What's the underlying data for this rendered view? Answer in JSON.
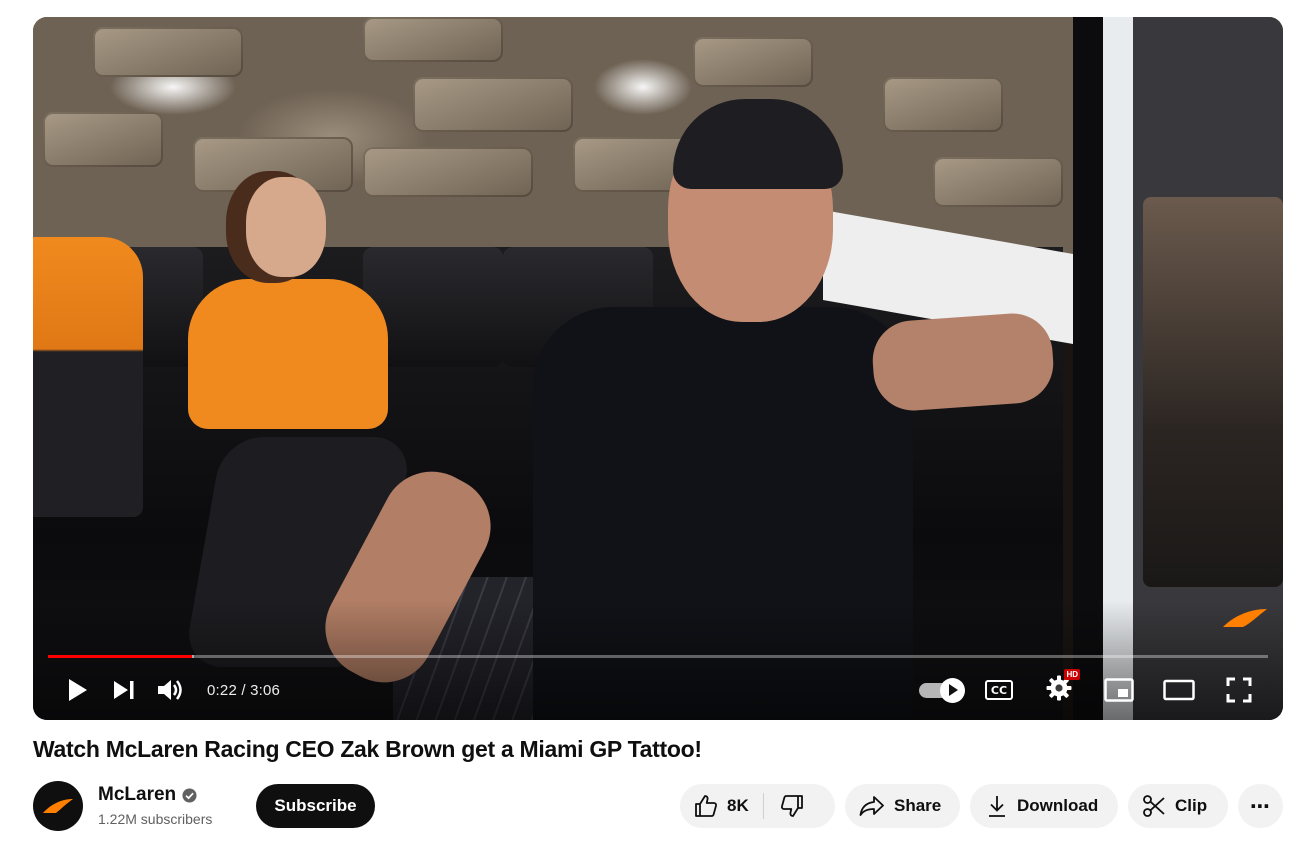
{
  "video": {
    "current_time": "0:22",
    "duration": "3:06",
    "time_display": "0:22 / 3:06",
    "progress_fraction": 0.118,
    "buffered_fraction": 0.12,
    "quality_badge": "HD",
    "captions_label": "CC",
    "autoplay_on": true,
    "watermark": "mclaren-logo"
  },
  "title": "Watch McLaren Racing CEO Zak Brown get a Miami GP Tattoo!",
  "channel": {
    "name": "McLaren",
    "verified": true,
    "subscribers": "1.22M subscribers",
    "subscribe_label": "Subscribe"
  },
  "actions": {
    "like_count": "8K",
    "share_label": "Share",
    "download_label": "Download",
    "clip_label": "Clip",
    "more_label": "⋯"
  },
  "icons": {
    "play": "play-icon",
    "next": "next-icon",
    "volume": "volume-icon",
    "autoplay": "autoplay-toggle",
    "captions": "captions-icon",
    "settings": "gear-icon",
    "miniplayer": "miniplayer-icon",
    "theater": "theater-mode-icon",
    "fullscreen": "fullscreen-icon",
    "like": "thumbs-up-icon",
    "dislike": "thumbs-down-icon",
    "share": "share-arrow-icon",
    "download": "download-icon",
    "clip": "scissors-icon",
    "more": "more-horizontal-icon"
  },
  "colors": {
    "progress": "#ff0000",
    "brand_orange": "#ff8000",
    "pill_bg": "#f2f2f2",
    "subscribe_bg": "#0f0f0f"
  }
}
